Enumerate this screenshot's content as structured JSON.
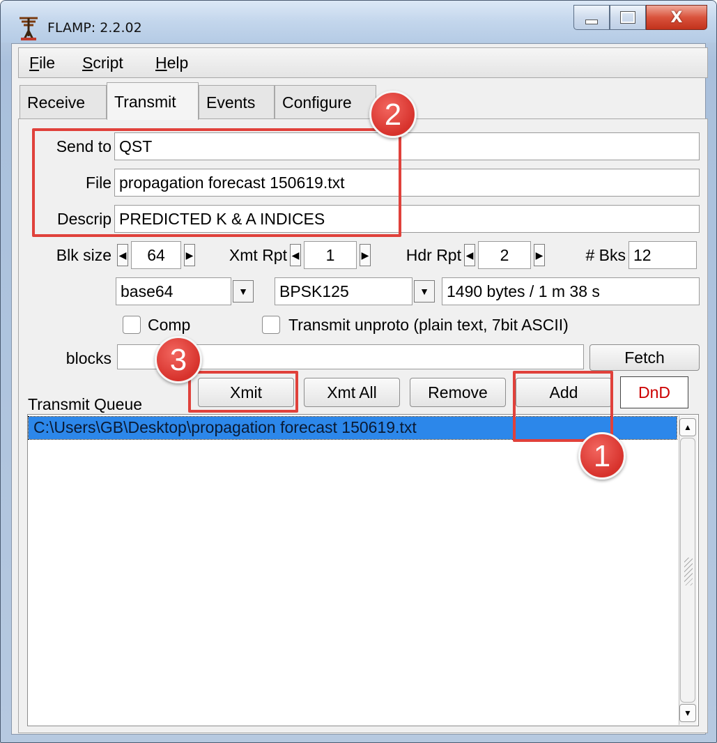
{
  "window": {
    "title": "FLAMP: 2.2.02",
    "icon": "antenna-icon",
    "close_glyph": "X"
  },
  "menu": [
    {
      "label": "File",
      "key": "F",
      "rest": "ile"
    },
    {
      "label": "Script",
      "key": "S",
      "rest": "cript"
    },
    {
      "label": "Help",
      "key": "H",
      "rest": "elp"
    }
  ],
  "tabs": [
    "Receive",
    "Transmit",
    "Events",
    "Configure"
  ],
  "active_tab": "Transmit",
  "form": {
    "send_to_label": "Send to",
    "send_to_value": "QST",
    "file_label": "File",
    "file_value": "propagation forecast 150619.txt",
    "descrip_label": "Descrip",
    "descrip_value": "PREDICTED K & A INDICES"
  },
  "params": {
    "blk_size_label": "Blk size",
    "blk_size_value": "64",
    "xmt_rpt_label": "Xmt Rpt",
    "xmt_rpt_value": "1",
    "hdr_rpt_label": "Hdr Rpt",
    "hdr_rpt_value": "2",
    "bks_label": "# Bks",
    "bks_value": "12"
  },
  "encoding": {
    "encoder": "base64",
    "mode": "BPSK125",
    "size_time": "1490 bytes / 1 m 38 s"
  },
  "options": {
    "comp_label": "Comp",
    "comp_checked": false,
    "unproto_label": "Transmit unproto (plain text, 7bit ASCII)",
    "unproto_checked": false
  },
  "blocks": {
    "label": "blocks",
    "value": "",
    "fetch_label": "Fetch"
  },
  "queue": {
    "label": "Transmit Queue",
    "buttons": {
      "xmit": "Xmit",
      "xmt_all": "Xmt All",
      "remove": "Remove",
      "add": "Add",
      "dnd": "DnD"
    },
    "items": [
      "C:\\Users\\GB\\Desktop\\propagation forecast 150619.txt"
    ]
  },
  "annotations": {
    "badge_1": "1",
    "badge_2": "2",
    "badge_3": "3",
    "color": "#e0413b"
  },
  "colors": {
    "selection": "#2c87ea",
    "dnd_text": "#cc0000"
  }
}
